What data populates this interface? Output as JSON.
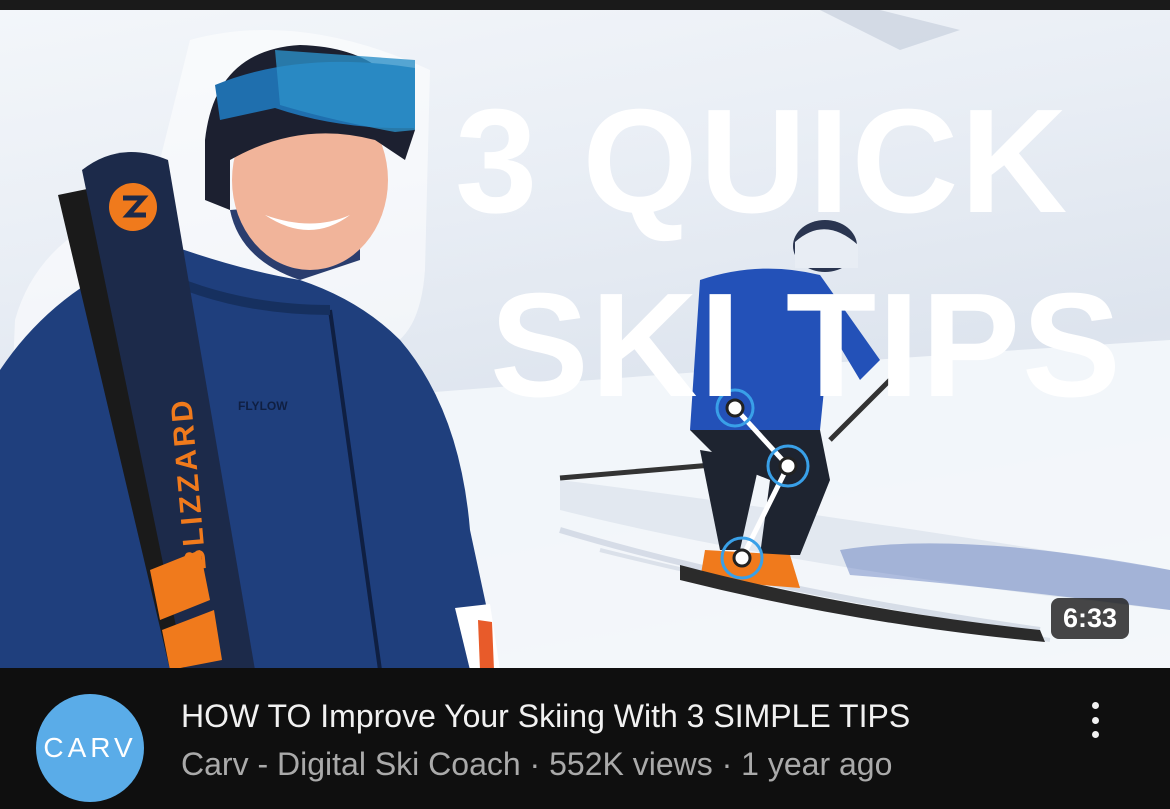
{
  "thumbnail": {
    "title_line1": "3 QUICK",
    "title_line2": "SKI TIPS",
    "duration": "6:33",
    "ski_brand_text": "BLIZZARD",
    "jacket_brand_text": "FLYLOW",
    "accent_orange": "#f07a1c",
    "jacket_blue": "#1f3f7d"
  },
  "video": {
    "title": "HOW TO Improve Your Skiing With 3 SIMPLE TIPS",
    "channel": "Carv - Digital Ski Coach",
    "separator": " · ",
    "views": "552K views",
    "age": "1 year ago"
  },
  "channel_avatar": {
    "text": "CARV",
    "color": "#5aace8"
  },
  "menu": {
    "icon": "more-vert-icon"
  }
}
